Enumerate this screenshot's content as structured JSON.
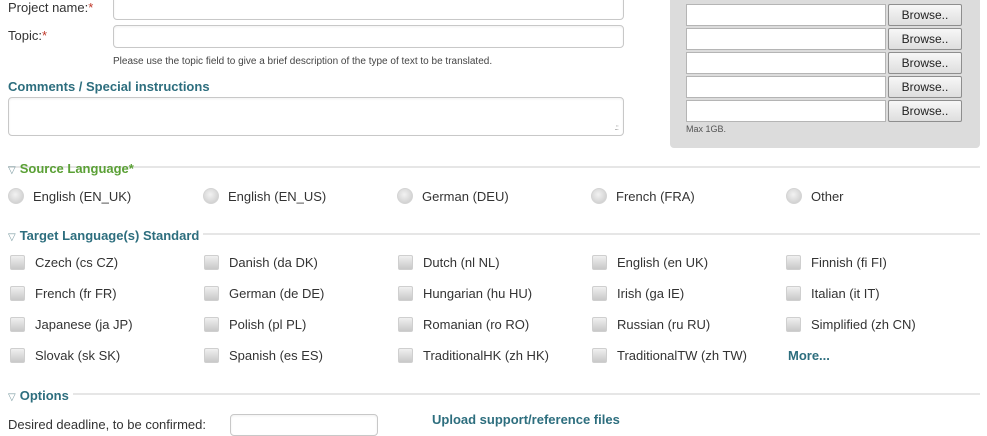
{
  "form": {
    "project_name_label": "Project name:",
    "topic_label": "Topic:",
    "required_mark": "*",
    "topic_hint": "Please use the topic field to give a brief description of the type of text to be translated.",
    "comments_title": "Comments / Special instructions"
  },
  "upload": {
    "browse_label": "Browse..",
    "max_note": "Max 1GB."
  },
  "source_language": {
    "title": "Source Language",
    "required_mark": "*",
    "options": [
      "English (EN_UK)",
      "English (EN_US)",
      "German (DEU)",
      "French (FRA)",
      "Other"
    ]
  },
  "target_languages": {
    "title": "Target Language(s) Standard",
    "rows": [
      [
        "Czech (cs CZ)",
        "Danish (da DK)",
        "Dutch (nl NL)",
        "English (en UK)",
        "Finnish (fi FI)"
      ],
      [
        "French (fr FR)",
        "German (de DE)",
        "Hungarian (hu HU)",
        "Irish (ga IE)",
        "Italian (it IT)"
      ],
      [
        "Japanese (ja JP)",
        "Polish (pl PL)",
        "Romanian (ro RO)",
        "Russian (ru RU)",
        "Simplified (zh CN)"
      ],
      [
        "Slovak (sk SK)",
        "Spanish (es ES)",
        "TraditionalHK (zh HK)",
        "TraditionalTW (zh TW)"
      ]
    ],
    "more_label": "More..."
  },
  "options": {
    "title": "Options",
    "deadline_label": "Desired deadline, to be confirmed:",
    "support_files_label": "Upload support/reference files"
  }
}
